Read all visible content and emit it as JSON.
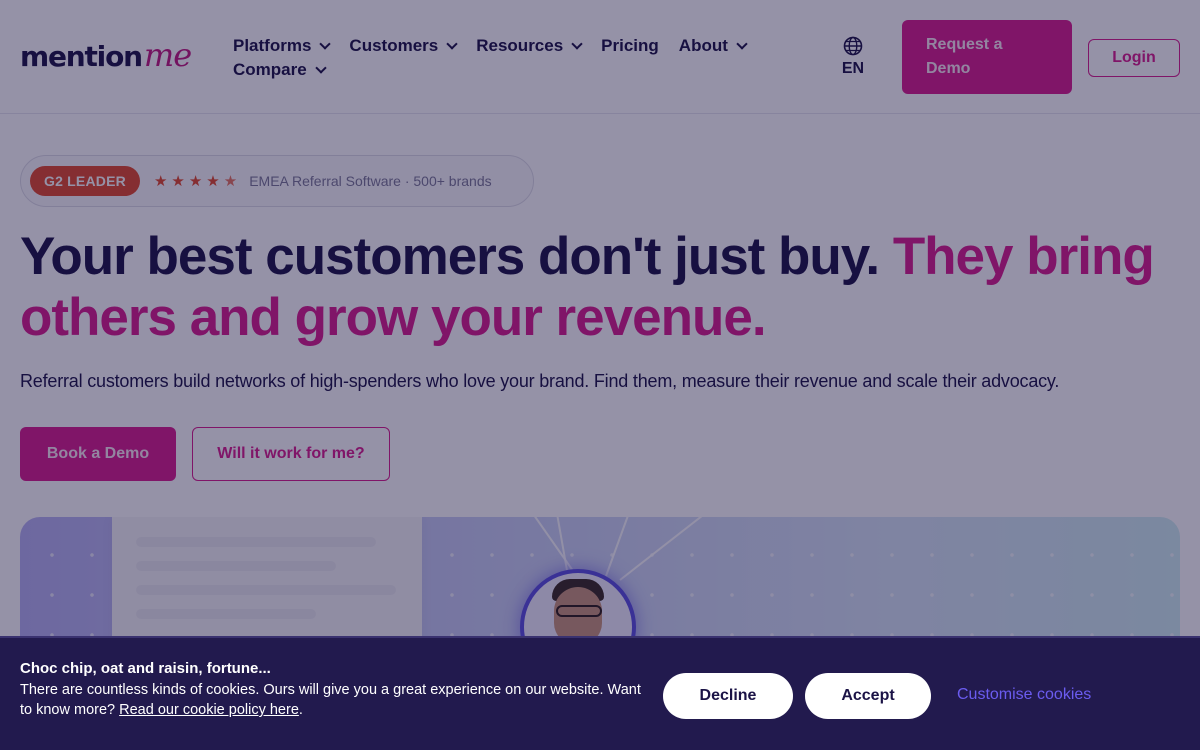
{
  "brand": {
    "logo_main": "mention",
    "logo_accent": "me"
  },
  "nav": {
    "items": [
      {
        "label": "Platforms",
        "has_menu": true
      },
      {
        "label": "Customers",
        "has_menu": true
      },
      {
        "label": "Resources",
        "has_menu": true
      },
      {
        "label": "Pricing",
        "has_menu": false
      },
      {
        "label": "About",
        "has_menu": true
      },
      {
        "label": "Compare",
        "has_menu": true
      }
    ],
    "language": "EN",
    "language_icon": "globe-icon",
    "request_demo_label": "Request a Demo",
    "login_label": "Login"
  },
  "badge": {
    "tag": "G2 LEADER",
    "rating_stars": 4.5,
    "text": "EMEA Referral Software · 500+ brands"
  },
  "hero": {
    "title_dark": "Your best customers don't just buy.",
    "title_accent": "They bring others and grow your revenue.",
    "subtitle": "Referral customers build networks of high-spenders who love your brand. Find them, measure their revenue and scale their advocacy.",
    "primary_cta": "Book a Demo",
    "secondary_cta": "Will it work for me?"
  },
  "cookie_banner": {
    "title": "Choc chip, oat and raisin, fortune...",
    "text": "There are countless kinds of cookies. Ours will give you a great experience on our website. Want to know more?",
    "policy_link": "Read our cookie policy here",
    "decline_label": "Decline",
    "accept_label": "Accept",
    "customise_label": "Customise cookies"
  },
  "colors": {
    "brand_pink": "#d91d8c",
    "navy": "#1b1346",
    "g2_orange": "#e2492b",
    "cookie_bg": "#221a4e",
    "customise_link": "#6b5cf0"
  }
}
